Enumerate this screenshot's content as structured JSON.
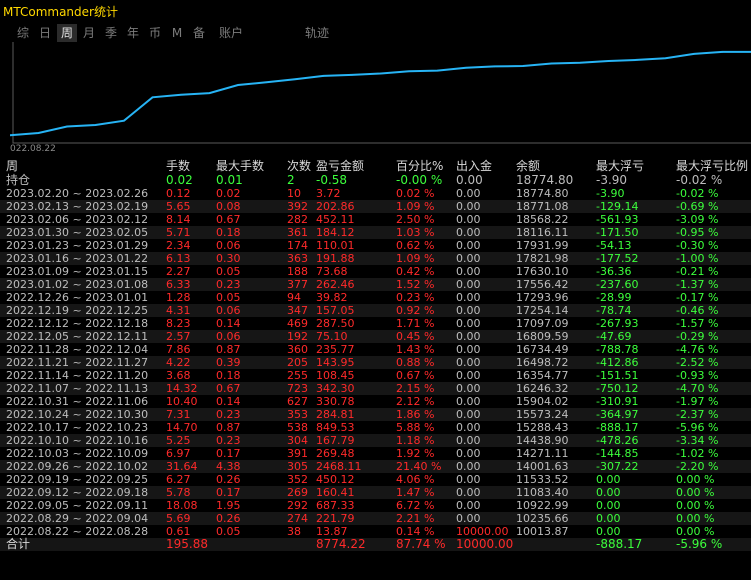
{
  "app": {
    "title": "MTCommander统计"
  },
  "tabs": [
    {
      "label": "综"
    },
    {
      "label": "日"
    },
    {
      "label": "周",
      "active": true
    },
    {
      "label": "月"
    },
    {
      "label": "季"
    },
    {
      "label": "年"
    },
    {
      "label": "币"
    },
    {
      "label": "M"
    },
    {
      "label": "备"
    },
    {
      "label": "账户"
    },
    {
      "label": "轨迹"
    }
  ],
  "chart_data": {
    "type": "line",
    "x_tick_label": "022.08.22",
    "x": [
      "2022.08.22",
      "2022.08.29",
      "2022.09.05",
      "2022.09.12",
      "2022.09.19",
      "2022.09.26",
      "2022.10.03",
      "2022.10.10",
      "2022.10.17",
      "2022.10.24",
      "2022.10.31",
      "2022.11.07",
      "2022.11.14",
      "2022.11.21",
      "2022.11.28",
      "2022.12.05",
      "2022.12.12",
      "2022.12.19",
      "2022.12.26",
      "2023.01.02",
      "2023.01.09",
      "2023.01.16",
      "2023.01.23",
      "2023.01.30",
      "2023.02.06",
      "2023.02.13",
      "2023.02.20"
    ],
    "values": [
      10013.87,
      10235.66,
      10922.99,
      11083.4,
      11533.52,
      14001.63,
      14271.11,
      14438.9,
      15288.43,
      15573.24,
      15904.02,
      16246.32,
      16354.77,
      16498.72,
      16734.49,
      16809.59,
      17097.09,
      17254.14,
      17293.96,
      17556.42,
      17630.1,
      17821.98,
      17931.99,
      18116.11,
      18568.22,
      18771.08,
      18774.8
    ],
    "color": "#27b4f5"
  },
  "table": {
    "headers": [
      "周",
      "手数",
      "最大手数",
      "次数",
      "盈亏金额",
      "百分比%",
      "出入金",
      "余额",
      "最大浮亏",
      "最大浮亏比例"
    ],
    "holding": [
      "持仓",
      "0.02",
      "0.01",
      "2",
      "-0.58",
      "-0.00 %",
      "0.00",
      "18774.80",
      "-3.90",
      "-0.02 %"
    ],
    "rows": [
      [
        "2023.02.20 ~ 2023.02.26",
        "0.12",
        "0.02",
        "10",
        "3.72",
        "0.02 %",
        "0.00",
        "18774.80",
        "-3.90",
        "-0.02 %"
      ],
      [
        "2023.02.13 ~ 2023.02.19",
        "5.65",
        "0.08",
        "392",
        "202.86",
        "1.09 %",
        "0.00",
        "18771.08",
        "-129.14",
        "-0.69 %"
      ],
      [
        "2023.02.06 ~ 2023.02.12",
        "8.14",
        "0.67",
        "282",
        "452.11",
        "2.50 %",
        "0.00",
        "18568.22",
        "-561.93",
        "-3.09 %"
      ],
      [
        "2023.01.30 ~ 2023.02.05",
        "5.71",
        "0.18",
        "361",
        "184.12",
        "1.03 %",
        "0.00",
        "18116.11",
        "-171.50",
        "-0.95 %"
      ],
      [
        "2023.01.23 ~ 2023.01.29",
        "2.34",
        "0.06",
        "174",
        "110.01",
        "0.62 %",
        "0.00",
        "17931.99",
        "-54.13",
        "-0.30 %"
      ],
      [
        "2023.01.16 ~ 2023.01.22",
        "6.13",
        "0.30",
        "363",
        "191.88",
        "1.09 %",
        "0.00",
        "17821.98",
        "-177.52",
        "-1.00 %"
      ],
      [
        "2023.01.09 ~ 2023.01.15",
        "2.27",
        "0.05",
        "188",
        "73.68",
        "0.42 %",
        "0.00",
        "17630.10",
        "-36.36",
        "-0.21 %"
      ],
      [
        "2023.01.02 ~ 2023.01.08",
        "6.33",
        "0.23",
        "377",
        "262.46",
        "1.52 %",
        "0.00",
        "17556.42",
        "-237.60",
        "-1.37 %"
      ],
      [
        "2022.12.26 ~ 2023.01.01",
        "1.28",
        "0.05",
        "94",
        "39.82",
        "0.23 %",
        "0.00",
        "17293.96",
        "-28.99",
        "-0.17 %"
      ],
      [
        "2022.12.19 ~ 2022.12.25",
        "4.31",
        "0.06",
        "347",
        "157.05",
        "0.92 %",
        "0.00",
        "17254.14",
        "-78.74",
        "-0.46 %"
      ],
      [
        "2022.12.12 ~ 2022.12.18",
        "8.23",
        "0.14",
        "469",
        "287.50",
        "1.71 %",
        "0.00",
        "17097.09",
        "-267.93",
        "-1.57 %"
      ],
      [
        "2022.12.05 ~ 2022.12.11",
        "2.57",
        "0.06",
        "192",
        "75.10",
        "0.45 %",
        "0.00",
        "16809.59",
        "-47.69",
        "-0.29 %"
      ],
      [
        "2022.11.28 ~ 2022.12.04",
        "7.86",
        "0.87",
        "360",
        "235.77",
        "1.43 %",
        "0.00",
        "16734.49",
        "-788.78",
        "-4.76 %"
      ],
      [
        "2022.11.21 ~ 2022.11.27",
        "4.22",
        "0.39",
        "205",
        "143.95",
        "0.88 %",
        "0.00",
        "16498.72",
        "-412.86",
        "-2.52 %"
      ],
      [
        "2022.11.14 ~ 2022.11.20",
        "3.68",
        "0.18",
        "255",
        "108.45",
        "0.67 %",
        "0.00",
        "16354.77",
        "-151.51",
        "-0.93 %"
      ],
      [
        "2022.11.07 ~ 2022.11.13",
        "14.32",
        "0.67",
        "723",
        "342.30",
        "2.15 %",
        "0.00",
        "16246.32",
        "-750.12",
        "-4.70 %"
      ],
      [
        "2022.10.31 ~ 2022.11.06",
        "10.40",
        "0.14",
        "627",
        "330.78",
        "2.12 %",
        "0.00",
        "15904.02",
        "-310.91",
        "-1.97 %"
      ],
      [
        "2022.10.24 ~ 2022.10.30",
        "7.31",
        "0.23",
        "353",
        "284.81",
        "1.86 %",
        "0.00",
        "15573.24",
        "-364.97",
        "-2.37 %"
      ],
      [
        "2022.10.17 ~ 2022.10.23",
        "14.70",
        "0.87",
        "538",
        "849.53",
        "5.88 %",
        "0.00",
        "15288.43",
        "-888.17",
        "-5.96 %"
      ],
      [
        "2022.10.10 ~ 2022.10.16",
        "5.25",
        "0.23",
        "304",
        "167.79",
        "1.18 %",
        "0.00",
        "14438.90",
        "-478.26",
        "-3.34 %"
      ],
      [
        "2022.10.03 ~ 2022.10.09",
        "6.97",
        "0.17",
        "391",
        "269.48",
        "1.92 %",
        "0.00",
        "14271.11",
        "-144.85",
        "-1.02 %"
      ],
      [
        "2022.09.26 ~ 2022.10.02",
        "31.64",
        "4.38",
        "305",
        "2468.11",
        "21.40 %",
        "0.00",
        "14001.63",
        "-307.22",
        "-2.20 %"
      ],
      [
        "2022.09.19 ~ 2022.09.25",
        "6.27",
        "0.26",
        "352",
        "450.12",
        "4.06 %",
        "0.00",
        "11533.52",
        "0.00",
        "0.00 %"
      ],
      [
        "2022.09.12 ~ 2022.09.18",
        "5.78",
        "0.17",
        "269",
        "160.41",
        "1.47 %",
        "0.00",
        "11083.40",
        "0.00",
        "0.00 %"
      ],
      [
        "2022.09.05 ~ 2022.09.11",
        "18.08",
        "1.95",
        "292",
        "687.33",
        "6.72 %",
        "0.00",
        "10922.99",
        "0.00",
        "0.00 %"
      ],
      [
        "2022.08.29 ~ 2022.09.04",
        "5.69",
        "0.26",
        "274",
        "221.79",
        "2.21 %",
        "0.00",
        "10235.66",
        "0.00",
        "0.00 %"
      ],
      [
        "2022.08.22 ~ 2022.08.28",
        "0.61",
        "0.05",
        "38",
        "13.87",
        "0.14 %",
        "10000.00",
        "10013.87",
        "0.00",
        "0.00 %"
      ]
    ],
    "total": [
      "合计",
      "195.88",
      "",
      "",
      "8774.22",
      "87.74 %",
      "10000.00",
      "",
      "-888.17",
      "-5.96 %"
    ]
  }
}
